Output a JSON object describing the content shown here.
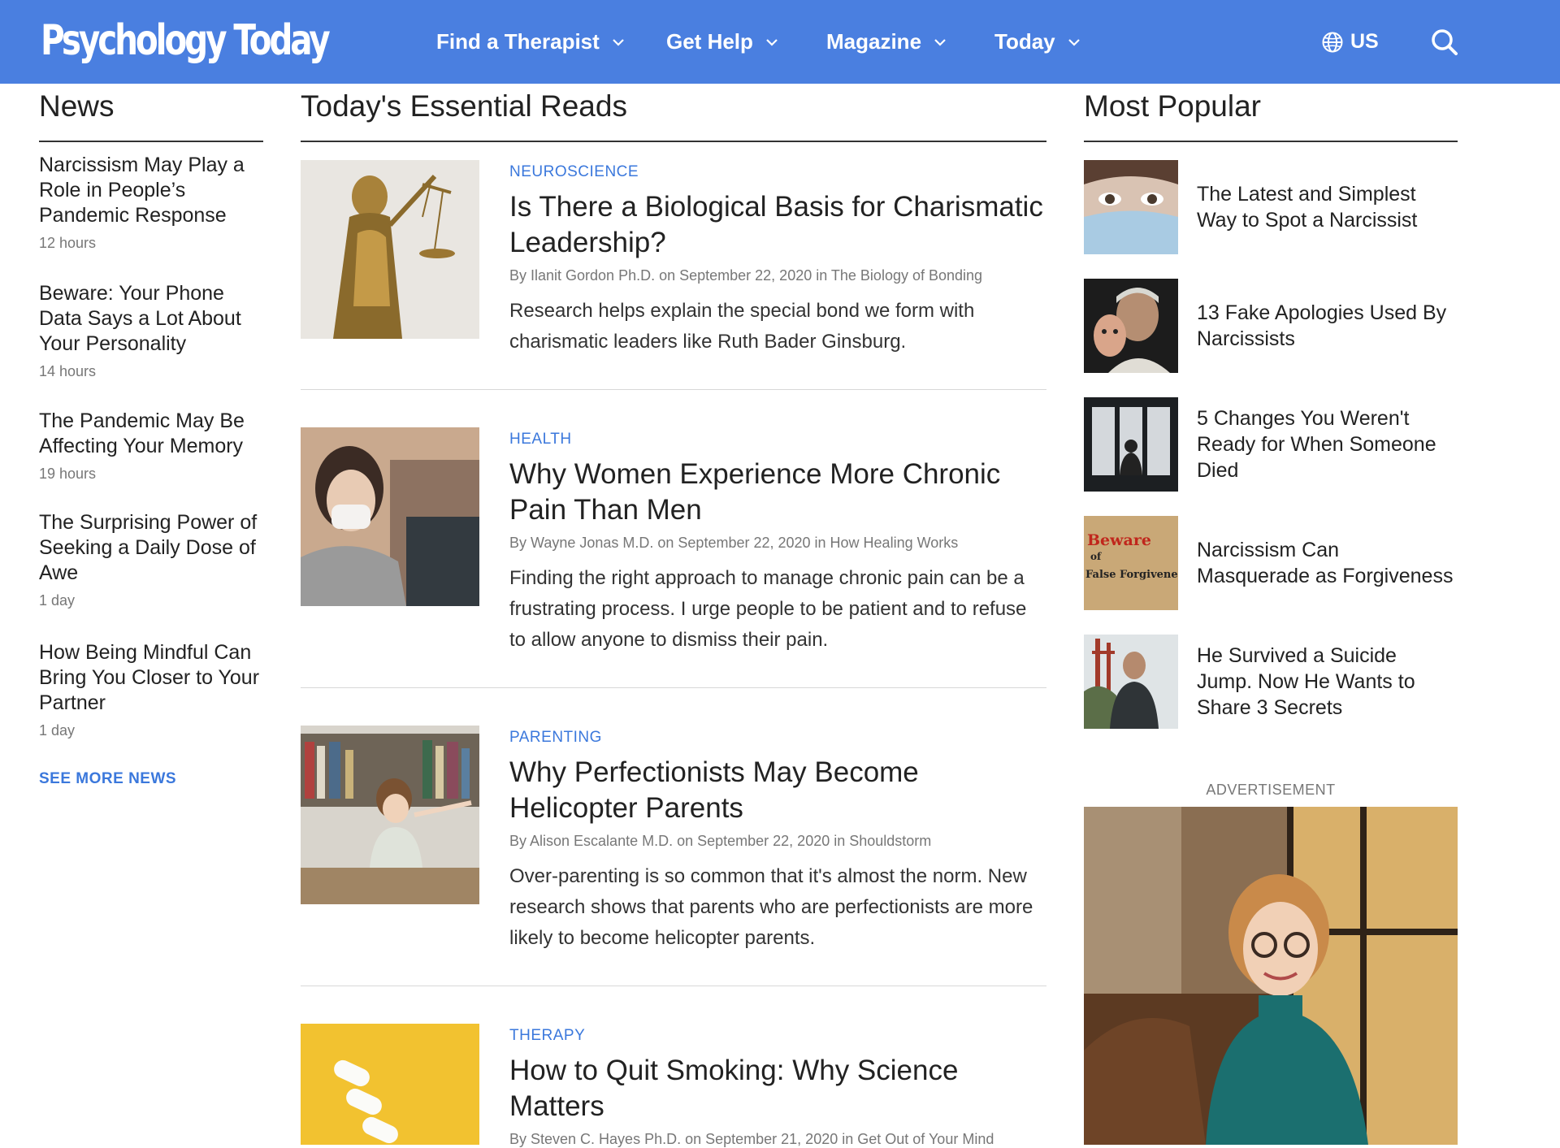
{
  "header": {
    "logo": "Psychology Today",
    "nav": [
      {
        "label": "Find a Therapist"
      },
      {
        "label": "Get Help"
      },
      {
        "label": "Magazine"
      },
      {
        "label": "Today"
      }
    ],
    "region": "US",
    "brand_color": "#4a7fe0"
  },
  "news": {
    "heading": "News",
    "items": [
      {
        "title": "Narcissism May Play a Role in People’s Pandemic Response",
        "time": "12 hours"
      },
      {
        "title": "Beware: Your Phone Data Says a Lot About Your Personality",
        "time": "14 hours"
      },
      {
        "title": "The Pandemic May Be Affecting Your Memory",
        "time": "19 hours"
      },
      {
        "title": "The Surprising Power of Seeking a Daily Dose of Awe",
        "time": "1 day"
      },
      {
        "title": "How Being Mindful Can Bring You Closer to Your Partner",
        "time": "1 day"
      }
    ],
    "see_more": "SEE MORE NEWS"
  },
  "reads": {
    "heading": "Today's Essential Reads",
    "articles": [
      {
        "category": "NEUROSCIENCE",
        "title": "Is There a Biological Basis for Charismatic Leadership?",
        "byline": "By Ilanit Gordon Ph.D. on September 22, 2020 in The Biology of Bonding",
        "summary": "Research helps explain the special bond we form with charismatic leaders like Ruth Bader Ginsburg."
      },
      {
        "category": "HEALTH",
        "title": "Why Women Experience More Chronic Pain Than Men",
        "byline": "By Wayne Jonas M.D. on September 22, 2020 in How Healing Works",
        "summary": "Finding the right approach to manage chronic pain can be a frustrating process. I urge people to be patient and to refuse to allow anyone to dismiss their pain."
      },
      {
        "category": "PARENTING",
        "title": "Why Perfectionists May Become Helicopter Parents",
        "byline": "By Alison Escalante M.D. on September 22, 2020 in Shouldstorm",
        "summary": "Over-parenting is so common that it's almost the norm. New research shows that parents who are perfectionists are more likely to become helicopter parents."
      },
      {
        "category": "THERAPY",
        "title": "How to Quit Smoking: Why Science Matters",
        "byline": "By Steven C. Hayes Ph.D. on September 21, 2020 in Get Out of Your Mind",
        "summary": ""
      }
    ]
  },
  "popular": {
    "heading": "Most Popular",
    "items": [
      {
        "title": "The Latest and Simplest Way to Spot a Narcissist"
      },
      {
        "title": "13 Fake Apologies Used By Narcissists"
      },
      {
        "title": "5 Changes You Weren't Ready for When Someone Died"
      },
      {
        "title": "Narcissism Can Masquerade as Forgiveness"
      },
      {
        "title": "He Survived a Suicide Jump. Now He Wants to Share 3 Secrets"
      }
    ],
    "thumb_text": {
      "line1": "Beware",
      "line2": "of",
      "line3": "False Forgiveness"
    },
    "ad_label": "ADVERTISEMENT"
  },
  "accent_color": "#3b78dc"
}
